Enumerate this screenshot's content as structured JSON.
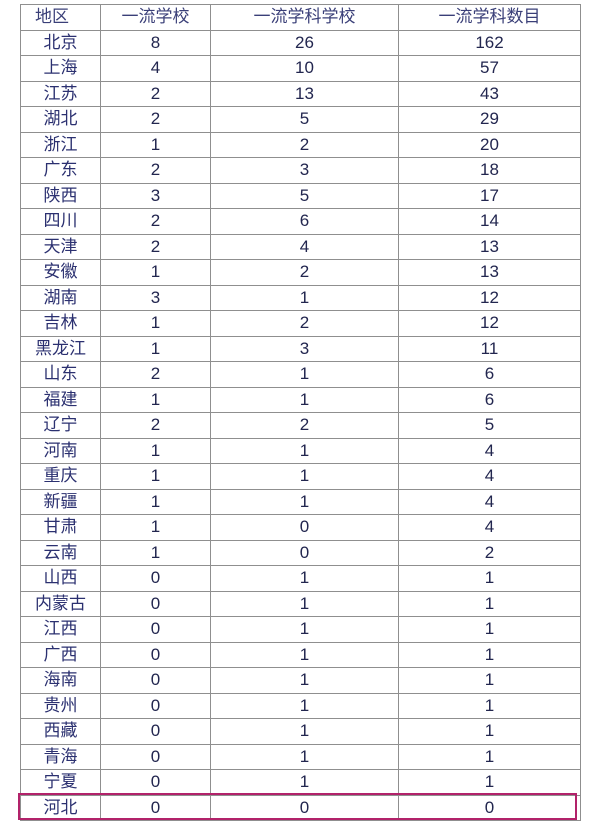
{
  "table": {
    "headers": [
      "地区",
      "一流学校",
      "一流学科学校",
      "一流学科数目"
    ],
    "rows": [
      [
        "北京",
        "8",
        "26",
        "162"
      ],
      [
        "上海",
        "4",
        "10",
        "57"
      ],
      [
        "江苏",
        "2",
        "13",
        "43"
      ],
      [
        "湖北",
        "2",
        "5",
        "29"
      ],
      [
        "浙江",
        "1",
        "2",
        "20"
      ],
      [
        "广东",
        "2",
        "3",
        "18"
      ],
      [
        "陕西",
        "3",
        "5",
        "17"
      ],
      [
        "四川",
        "2",
        "6",
        "14"
      ],
      [
        "天津",
        "2",
        "4",
        "13"
      ],
      [
        "安徽",
        "1",
        "2",
        "13"
      ],
      [
        "湖南",
        "3",
        "1",
        "12"
      ],
      [
        "吉林",
        "1",
        "2",
        "12"
      ],
      [
        "黑龙江",
        "1",
        "3",
        "11"
      ],
      [
        "山东",
        "2",
        "1",
        "6"
      ],
      [
        "福建",
        "1",
        "1",
        "6"
      ],
      [
        "辽宁",
        "2",
        "2",
        "5"
      ],
      [
        "河南",
        "1",
        "1",
        "4"
      ],
      [
        "重庆",
        "1",
        "1",
        "4"
      ],
      [
        "新疆",
        "1",
        "1",
        "4"
      ],
      [
        "甘肃",
        "1",
        "0",
        "4"
      ],
      [
        "云南",
        "1",
        "0",
        "2"
      ],
      [
        "山西",
        "0",
        "1",
        "1"
      ],
      [
        "内蒙古",
        "0",
        "1",
        "1"
      ],
      [
        "江西",
        "0",
        "1",
        "1"
      ],
      [
        "广西",
        "0",
        "1",
        "1"
      ],
      [
        "海南",
        "0",
        "1",
        "1"
      ],
      [
        "贵州",
        "0",
        "1",
        "1"
      ],
      [
        "西藏",
        "0",
        "1",
        "1"
      ],
      [
        "青海",
        "0",
        "1",
        "1"
      ],
      [
        "宁夏",
        "0",
        "1",
        "1"
      ],
      [
        "河北",
        "0",
        "0",
        "0"
      ]
    ]
  },
  "highlight": {
    "row_label": "河北",
    "color": "#b2226a"
  }
}
